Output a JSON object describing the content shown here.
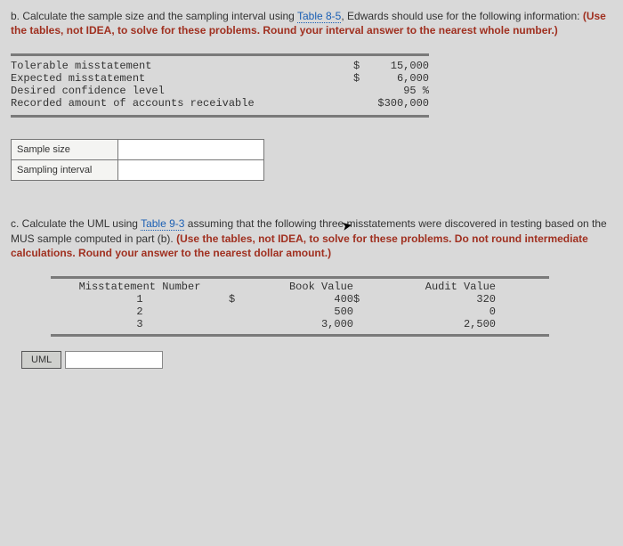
{
  "partB": {
    "prompt_prefix": "b. Calculate the sample size and the sampling interval using ",
    "table_link": "Table 8-5",
    "prompt_mid": ", Edwards should use for the following information: ",
    "prompt_bold": "(Use the tables, not IDEA, to solve for these problems. Round your interval answer to the nearest whole number.)"
  },
  "given": {
    "rows": [
      {
        "label": "Tolerable misstatement",
        "currency": "$",
        "value": "15,000"
      },
      {
        "label": "Expected misstatement",
        "currency": "$",
        "value": "6,000"
      },
      {
        "label": "Desired confidence level",
        "currency": "",
        "value": "95 %"
      },
      {
        "label": "Recorded amount of accounts receivable",
        "currency": "",
        "value": "$300,000"
      }
    ]
  },
  "answers": {
    "sample_size_label": "Sample size",
    "sampling_interval_label": "Sampling interval"
  },
  "partC": {
    "prefix": "c. Calculate the UML using ",
    "table_link": "Table 9-3",
    "mid": " assuming that the following three misstatements were discovered in testing based on the MUS sample computed in part (b). ",
    "bold": "(Use the tables, not IDEA, to solve for these problems. Do not round intermediate calculations. Round your answer to the nearest dollar amount.)"
  },
  "miss": {
    "headers": {
      "num": "Misstatement Number",
      "book": "Book Value",
      "audit": "Audit Value"
    },
    "rows": [
      {
        "n": "1",
        "bs": "$",
        "bv": "400",
        "as": "$",
        "av": "320"
      },
      {
        "n": "2",
        "bs": "",
        "bv": "500",
        "as": "",
        "av": "0"
      },
      {
        "n": "3",
        "bs": "",
        "bv": "3,000",
        "as": "",
        "av": "2,500"
      }
    ]
  },
  "uml": {
    "label": "UML"
  }
}
